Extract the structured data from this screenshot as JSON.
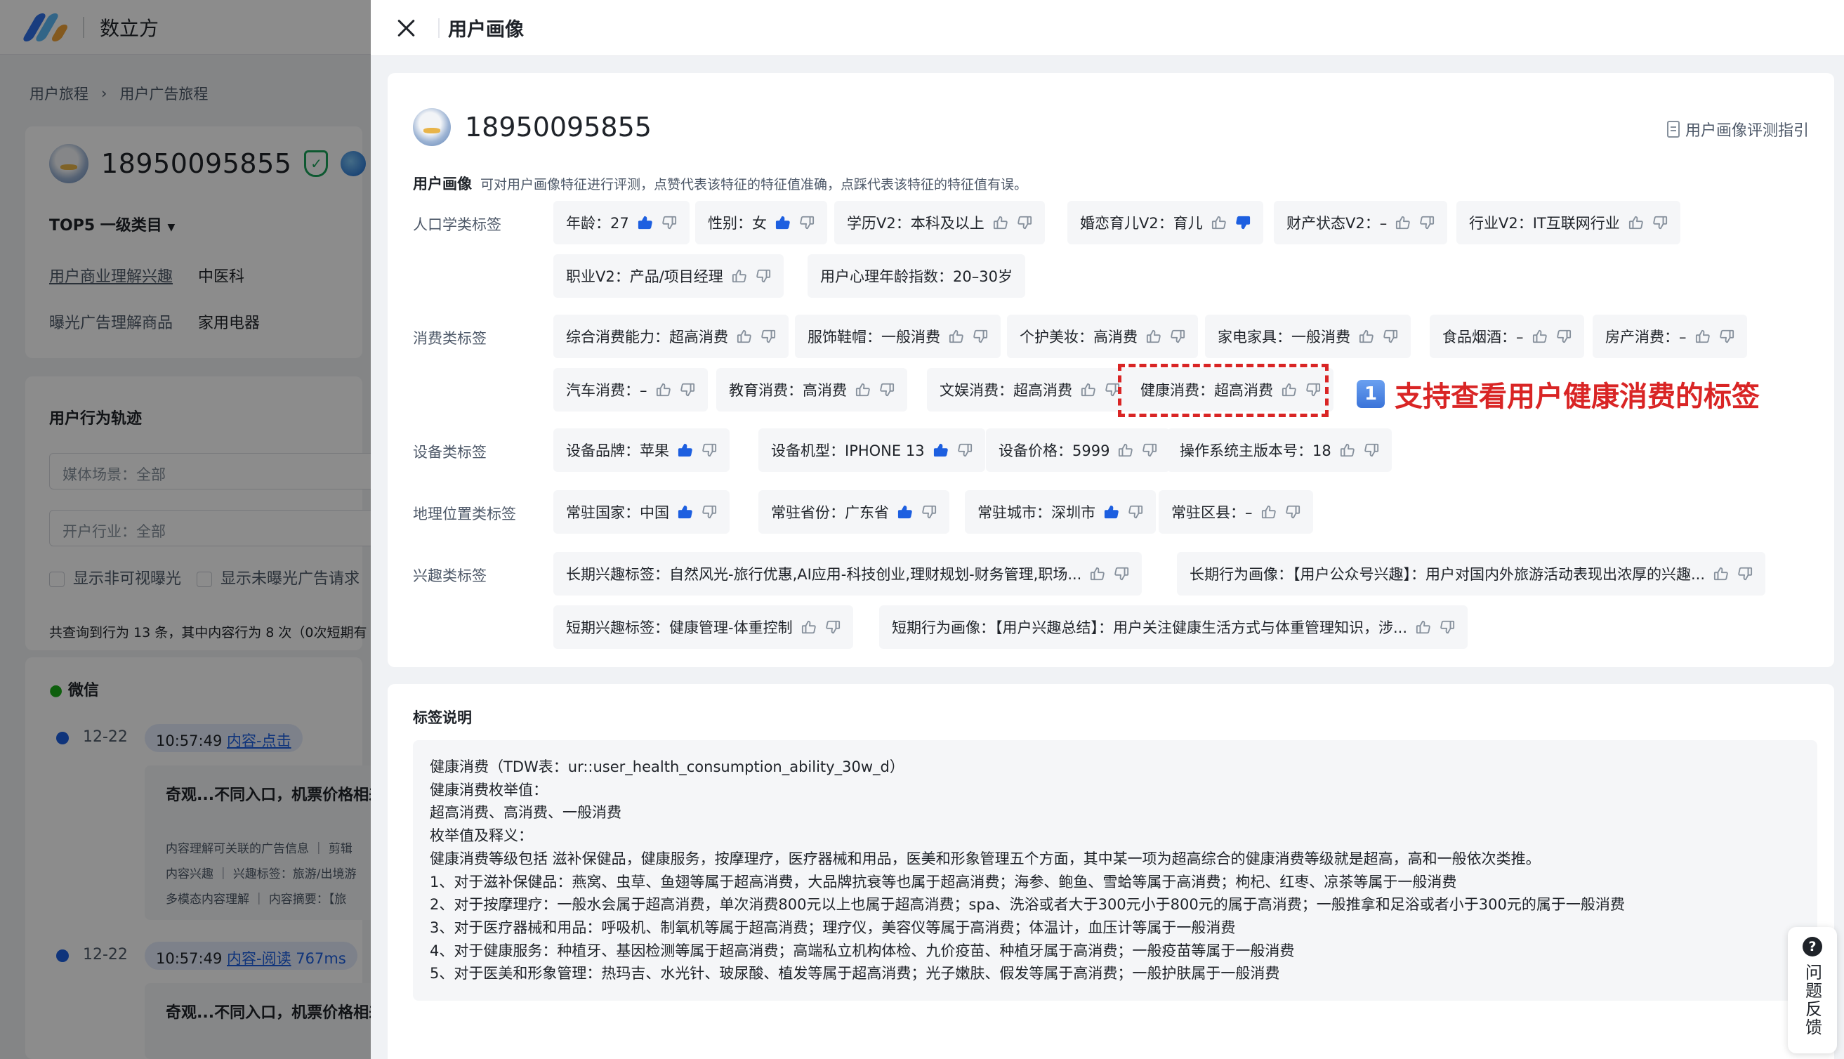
{
  "app": {
    "name": "数立方"
  },
  "breadcrumb": [
    "用户旅程",
    "用户广告旅程"
  ],
  "bg": {
    "uid": "18950095855",
    "top5_label": "TOP5 一级类目",
    "interest_rows": [
      {
        "label": "用户商业理解兴趣",
        "value": "中医科"
      },
      {
        "label": "曝光广告理解商品",
        "value": "家用电器"
      }
    ],
    "trajectory_title": "用户行为轨迹",
    "media_select": "媒体场景：全部",
    "industry_select": "开户行业：全部",
    "checkbox_invisible": "显示非可视曝光",
    "checkbox_unexposed": "显示未曝光广告请求",
    "query_summary": "共查询到行为 13 条，其中内容行为 8 次（0次短期有",
    "channel": "微信",
    "events": [
      {
        "date": "12-22",
        "time": "10:57:49",
        "action": "内容-点击",
        "extra": "",
        "title": "奇观...不同入口，机票价格相差",
        "meta": [
          [
            "内容理解可关联的广告信息",
            "剪辑"
          ],
          [
            "内容兴趣",
            "兴趣标签：旅游/出境游"
          ],
          [
            "多模态内容理解",
            "内容摘要：【旅"
          ]
        ]
      },
      {
        "date": "12-22",
        "time": "10:57:49",
        "action": "内容-阅读",
        "extra": "767ms",
        "title": "奇观...不同入口，机票价格相差"
      }
    ]
  },
  "drawer": {
    "title": "用户画像",
    "uid": "18950095855",
    "guide_link": "用户画像评测指引",
    "intro_label": "用户画像",
    "intro_text": "可对用户画像特征进行评测，点赞代表该特征的特征值准确，点踩代表该特征的特征值有误。",
    "categories": {
      "demographic": {
        "label": "人口学类标签",
        "tags": [
          {
            "text": "年龄：27",
            "up": true,
            "down": false
          },
          {
            "text": "性别：女",
            "up": true,
            "down": false
          },
          {
            "text": "学历V2：本科及以上",
            "up": false,
            "down": false
          },
          {
            "text": "婚恋育儿V2：育儿",
            "up": false,
            "down": true
          },
          {
            "text": "财产状态V2：–",
            "up": false,
            "down": false
          },
          {
            "text": "行业V2：IT互联网行业",
            "up": false,
            "down": false
          },
          {
            "text": "职业V2：产品/项目经理",
            "up": false,
            "down": false
          },
          {
            "text": "用户心理年龄指数：20–30岁"
          }
        ]
      },
      "consumption": {
        "label": "消费类标签",
        "tags": [
          {
            "text": "综合消费能力：超高消费",
            "up": false,
            "down": false
          },
          {
            "text": "服饰鞋帽：一般消费",
            "up": false,
            "down": false
          },
          {
            "text": "个护美妆：高消费",
            "up": false,
            "down": false
          },
          {
            "text": "家电家具：一般消费",
            "up": false,
            "down": false
          },
          {
            "text": "食品烟酒：–",
            "up": false,
            "down": false
          },
          {
            "text": "房产消费：–",
            "up": false,
            "down": false
          },
          {
            "text": "汽车消费：–",
            "up": false,
            "down": false
          },
          {
            "text": "教育消费：高消费",
            "up": false,
            "down": false
          },
          {
            "text": "文娱消费：超高消费",
            "up": false,
            "down": false
          },
          {
            "text": "健康消费：超高消费",
            "up": false,
            "down": false
          }
        ]
      },
      "device": {
        "label": "设备类标签",
        "tags": [
          {
            "text": "设备品牌：苹果",
            "up": true,
            "down": false
          },
          {
            "text": "设备机型：IPHONE 13",
            "up": true,
            "down": false
          },
          {
            "text": "设备价格：5999",
            "up": false,
            "down": false
          },
          {
            "text": "操作系统主版本号：18",
            "up": false,
            "down": false
          }
        ]
      },
      "location": {
        "label": "地理位置类标签",
        "tags": [
          {
            "text": "常驻国家：中国",
            "up": true,
            "down": false
          },
          {
            "text": "常驻省份：广东省",
            "up": true,
            "down": false
          },
          {
            "text": "常驻城市：深圳市",
            "up": true,
            "down": false
          },
          {
            "text": "常驻区县：–",
            "up": false,
            "down": false
          }
        ]
      },
      "interest": {
        "label": "兴趣类标签",
        "tags": [
          {
            "text": "长期兴趣标签：自然风光-旅行优惠,AI应用-科技创业,理财规划-财务管理,职场...",
            "up": false,
            "down": false
          },
          {
            "text": "长期行为画像：【用户公众号兴趣】：用户对国内外旅游活动表现出浓厚的兴趣...",
            "up": false,
            "down": false
          },
          {
            "text": "短期兴趣标签：健康管理-体重控制",
            "up": false,
            "down": false
          },
          {
            "text": "短期行为画像：【用户兴趣总结】：用户关注健康生活方式与体重管理知识，涉...",
            "up": false,
            "down": false
          }
        ]
      }
    },
    "callout": {
      "badge": "1",
      "text": "支持查看用户健康消费的标签"
    },
    "desc_title": "标签说明",
    "desc_lines": [
      "健康消费（TDW表：ur::user_health_consumption_ability_30w_d）",
      "健康消费枚举值：",
      "超高消费、高消费、一般消费",
      "枚举值及释义：",
      "健康消费等级包括 滋补保健品，健康服务，按摩理疗，医疗器械和用品，医美和形象管理五个方面，其中某一项为超高综合的健康消费等级就是超高，高和一般依次类推。",
      "1、对于滋补保健品：燕窝、虫草、鱼翅等属于超高消费，大品牌抗衰等也属于超高消费；海参、鲍鱼、雪蛤等属于高消费；枸杞、红枣、凉茶等属于一般消费",
      "2、对于按摩理疗：一般水会属于超高消费，单次消费800元以上也属于超高消费；spa、洗浴或者大于300元小于800元的属于高消费；一般推拿和足浴或者小于300元的属于一般消费",
      "3、对于医疗器械和用品：呼吸机、制氧机等属于超高消费；理疗仪，美容仪等属于高消费；体温计，血压计等属于一般消费",
      "4、对于健康服务：种植牙、基因检测等属于超高消费；高端私立机构体检、九价疫苗、种植牙属于高消费；一般疫苗等属于一般消费",
      "5、对于医美和形象管理：热玛吉、水光针、玻尿酸、植发等属于超高消费；光子嫩肤、假发等属于高消费；一般护肤属于一般消费"
    ],
    "feedback": {
      "icon": "?",
      "label": "问题反馈"
    }
  },
  "colors": {
    "accent": "#1d5fe0",
    "callout": "#d92525",
    "tag_bg": "#f5f6f8"
  }
}
